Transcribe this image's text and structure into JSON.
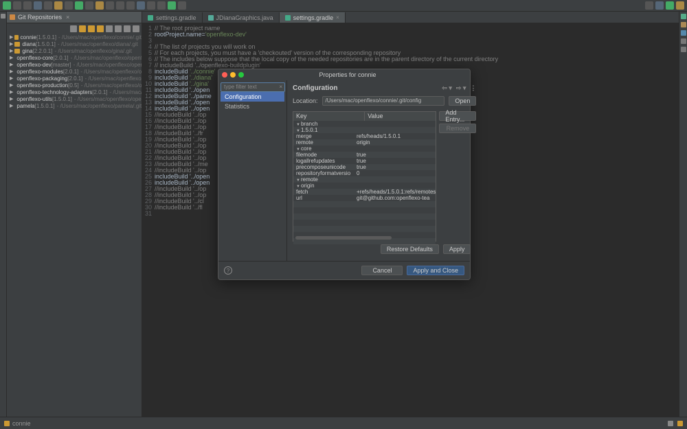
{
  "toolbar": {
    "icons": 18
  },
  "gitview": {
    "title": "Git Repositories",
    "repos": [
      {
        "name": "connie",
        "branch": "[1.5.0.1]",
        "path": "- /Users/mac/openflexo/connie/.git"
      },
      {
        "name": "diana",
        "branch": "[1.5.0.1]",
        "path": "- /Users/mac/openflexo/diana/.git"
      },
      {
        "name": "gina",
        "branch": "[2.2.0.1]",
        "path": "- /Users/mac/openflexo/gina/.git"
      },
      {
        "name": "openflexo-core",
        "branch": "[2.0.1]",
        "path": "- /Users/mac/openflexo/openflexo-c"
      },
      {
        "name": "openflexo-dev",
        "branch": "[master]",
        "path": "- /Users/mac/openflexo/openflexo"
      },
      {
        "name": "openflexo-modules",
        "branch": "[2.0.1]",
        "path": "- /Users/mac/openflexo/openfl"
      },
      {
        "name": "openflexo-packaging",
        "branch": "[2.0.1]",
        "path": "- /Users/mac/openflexo/open"
      },
      {
        "name": "openflexo-production",
        "branch": "[0.5]",
        "path": "- /Users/mac/openflexo/openfl"
      },
      {
        "name": "openflexo-technology-adapters",
        "branch": "[2.0.1]",
        "path": "- /Users/mac/open"
      },
      {
        "name": "openflexo-utils",
        "branch": "[1.5.0.1]",
        "path": "- /Users/mac/openflexo/openflexo"
      },
      {
        "name": "pamela",
        "branch": "[1.5.0.1]",
        "path": "- /Users/mac/openflexo/pamela/.git"
      }
    ]
  },
  "editor": {
    "tabs": [
      {
        "label": "settings.gradle",
        "active": false
      },
      {
        "label": "JDianaGraphics.java",
        "active": false
      },
      {
        "label": "settings.gradle",
        "active": true
      }
    ],
    "lines": [
      {
        "n": 1,
        "t": "// The root project name",
        "c": "cm"
      },
      {
        "n": 2,
        "t": "rootProject.name='openflexo-dev'",
        "c": ""
      },
      {
        "n": 3,
        "t": "",
        "c": ""
      },
      {
        "n": 4,
        "t": "// The list of projects you will work on",
        "c": "cm"
      },
      {
        "n": 5,
        "t": "// For each projects, you must have a 'checkouted' version of the corresponding repository",
        "c": "cm"
      },
      {
        "n": 6,
        "t": "// The includes below suppose that the local copy of the needed repositories are in the parent directory of the current directory",
        "c": "cm"
      },
      {
        "n": 7,
        "t": "// includeBuild '../openflexo-buildplugin'",
        "c": "cm"
      },
      {
        "n": 8,
        "t": "includeBuild '../connie'",
        "c": ""
      },
      {
        "n": 9,
        "t": "includeBuild '../diana'",
        "c": ""
      },
      {
        "n": 10,
        "t": "includeBuild '../gina'",
        "c": ""
      },
      {
        "n": 11,
        "t": "includeBuild '../open",
        "c": ""
      },
      {
        "n": 12,
        "t": "includeBuild '../pame",
        "c": ""
      },
      {
        "n": 13,
        "t": "includeBuild '../open",
        "c": ""
      },
      {
        "n": 14,
        "t": "includeBuild '../open",
        "c": ""
      },
      {
        "n": 15,
        "t": "//includeBuild '../op",
        "c": "cm"
      },
      {
        "n": 16,
        "t": "//includeBuild '../op",
        "c": "cm"
      },
      {
        "n": 17,
        "t": "//includeBuild '../op",
        "c": "cm"
      },
      {
        "n": 18,
        "t": "//includeBuild '../fr",
        "c": "cm"
      },
      {
        "n": 19,
        "t": "//includeBuild '../op",
        "c": "cm"
      },
      {
        "n": 20,
        "t": "//includeBuild '../op",
        "c": "cm"
      },
      {
        "n": 21,
        "t": "//includeBuild '../op",
        "c": "cm"
      },
      {
        "n": 22,
        "t": "//includeBuild '../op",
        "c": "cm"
      },
      {
        "n": 23,
        "t": "//includeBuild '../me",
        "c": "cm"
      },
      {
        "n": 24,
        "t": "//includeBuild '../op",
        "c": "cm"
      },
      {
        "n": 25,
        "t": "includeBuild '../open",
        "c": ""
      },
      {
        "n": 26,
        "t": "includeBuild '../open",
        "c": ""
      },
      {
        "n": 27,
        "t": "//includeBuild '../op",
        "c": "cm"
      },
      {
        "n": 28,
        "t": "//includeBuild '../op",
        "c": "cm"
      },
      {
        "n": 29,
        "t": "//includeBuild '../cl",
        "c": "cm"
      },
      {
        "n": 30,
        "t": "//includeBuild '../fl",
        "c": "cm"
      },
      {
        "n": 31,
        "t": "",
        "c": ""
      }
    ]
  },
  "dialog": {
    "title": "Properties for connie",
    "filter_placeholder": "type filter text",
    "categories": [
      {
        "label": "Configuration",
        "sel": true
      },
      {
        "label": "Statistics",
        "sel": false
      }
    ],
    "section_title": "Configuration",
    "location_label": "Location:",
    "location_value": "/Users/mac/openflexo/connie/.git/config",
    "open_label": "Open",
    "table": {
      "headers": {
        "key": "Key",
        "value": "Value"
      },
      "rows": [
        {
          "k": "branch",
          "v": "",
          "lvl": 0,
          "exp": true
        },
        {
          "k": "1.5.0.1",
          "v": "",
          "lvl": 1,
          "exp": true
        },
        {
          "k": "merge",
          "v": "refs/heads/1.5.0.1",
          "lvl": 2
        },
        {
          "k": "remote",
          "v": "origin",
          "lvl": 2
        },
        {
          "k": "core",
          "v": "",
          "lvl": 0,
          "exp": true
        },
        {
          "k": "filemode",
          "v": "true",
          "lvl": 2
        },
        {
          "k": "logallrefupdates",
          "v": "true",
          "lvl": 2
        },
        {
          "k": "precomposeunicode",
          "v": "true",
          "lvl": 2
        },
        {
          "k": "repositoryformatversio",
          "v": "0",
          "lvl": 2
        },
        {
          "k": "remote",
          "v": "",
          "lvl": 0,
          "exp": true
        },
        {
          "k": "origin",
          "v": "",
          "lvl": 1,
          "exp": true
        },
        {
          "k": "fetch",
          "v": "+refs/heads/1.5.0.1:refs/remotes",
          "lvl": 2
        },
        {
          "k": "url",
          "v": "git@github.com:openflexo-tea",
          "lvl": 2
        }
      ]
    },
    "add_entry": "Add Entry...",
    "remove": "Remove",
    "restore": "Restore Defaults",
    "apply": "Apply",
    "cancel": "Cancel",
    "apply_close": "Apply and Close"
  },
  "statusbar": {
    "text": "connie"
  }
}
